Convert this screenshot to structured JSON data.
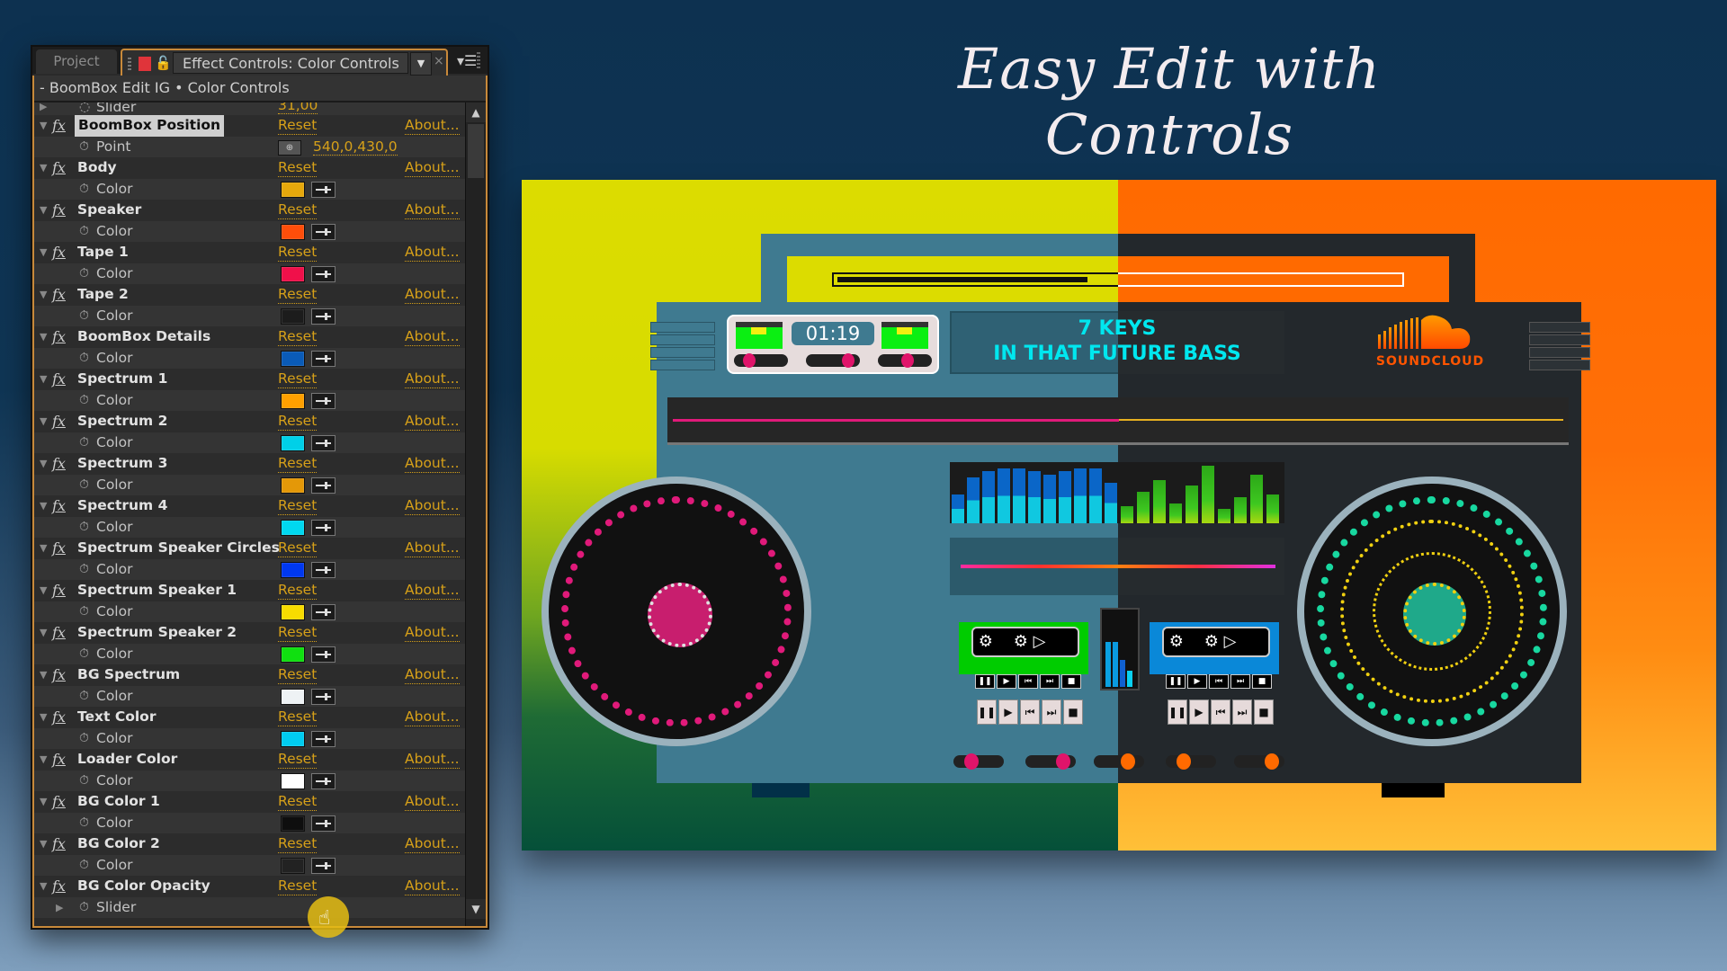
{
  "panel": {
    "tab_project": "Project",
    "tab_title": "Effect Controls: Color Controls",
    "comp_line": "- BoomBox Edit IG • Color Controls",
    "top_slider": {
      "label": "Slider",
      "value": "31,00"
    },
    "reset_label": "Reset",
    "about_label": "About...",
    "effects": [
      {
        "name": "BoomBox Position",
        "prop": "Point",
        "type": "point",
        "value": "540,0,430,0",
        "selected": true
      },
      {
        "name": "Body",
        "prop": "Color",
        "type": "color",
        "color": "#e6a80c"
      },
      {
        "name": "Speaker",
        "prop": "Color",
        "type": "color",
        "color": "#ff4e0a"
      },
      {
        "name": "Tape 1",
        "prop": "Color",
        "type": "color",
        "color": "#f0104a"
      },
      {
        "name": "Tape 2",
        "prop": "Color",
        "type": "color",
        "color": "#1c1c1c"
      },
      {
        "name": "BoomBox Details",
        "prop": "Color",
        "type": "color",
        "color": "#0a5bb8"
      },
      {
        "name": "Spectrum 1",
        "prop": "Color",
        "type": "color",
        "color": "#ffa000"
      },
      {
        "name": "Spectrum 2",
        "prop": "Color",
        "type": "color",
        "color": "#00d0e8"
      },
      {
        "name": "Spectrum 3",
        "prop": "Color",
        "type": "color",
        "color": "#e49808"
      },
      {
        "name": "Spectrum 4",
        "prop": "Color",
        "type": "color",
        "color": "#00d8f0"
      },
      {
        "name": "Spectrum Speaker Circles",
        "prop": "Color",
        "type": "color",
        "color": "#0038f0"
      },
      {
        "name": "Spectrum Speaker 1",
        "prop": "Color",
        "type": "color",
        "color": "#f8dc00"
      },
      {
        "name": "Spectrum Speaker 2",
        "prop": "Color",
        "type": "color",
        "color": "#10e010"
      },
      {
        "name": "BG Spectrum",
        "prop": "Color",
        "type": "color",
        "color": "#eef2f4"
      },
      {
        "name": "Text Color",
        "prop": "Color",
        "type": "color",
        "color": "#00ccf0"
      },
      {
        "name": "Loader Color",
        "prop": "Color",
        "type": "color",
        "color": "#ffffff"
      },
      {
        "name": "BG Color 1",
        "prop": "Color",
        "type": "color",
        "color": "#0e0e0e"
      },
      {
        "name": "BG Color 2",
        "prop": "Color",
        "type": "color",
        "color": "#222222"
      },
      {
        "name": "BG Color Opacity",
        "prop": "Slider",
        "type": "slider",
        "value": ""
      }
    ]
  },
  "headline": "Easy Edit with Controls",
  "artwork": {
    "deck_time": "01:19",
    "display_line1": "7 KEYS",
    "display_line2": "IN THAT FUTURE BASS",
    "brand": "SOUNDCLOUD",
    "colors": {
      "left_bg_top": "#dcdc00",
      "right_bg_top": "#ff6a00",
      "left_body": "#3f7a90",
      "right_body": "#23282c",
      "left_accent": "#e0146a",
      "right_accent": "#ff6a00",
      "display_text": "#00e7ef",
      "display_text_alt": "#3ef030"
    },
    "spectrum_levels_left": [
      0.5,
      0.8,
      0.9,
      0.95,
      0.95,
      0.9,
      0.85,
      0.9,
      0.95,
      0.95,
      0.7
    ],
    "spectrum_levels_right": [
      0.3,
      0.55,
      0.75,
      0.35,
      0.65,
      1.0,
      0.25,
      0.45,
      0.85,
      0.5
    ],
    "transport_labels": [
      "❚❚",
      "▶",
      "⏮",
      "⏭",
      "■"
    ]
  }
}
